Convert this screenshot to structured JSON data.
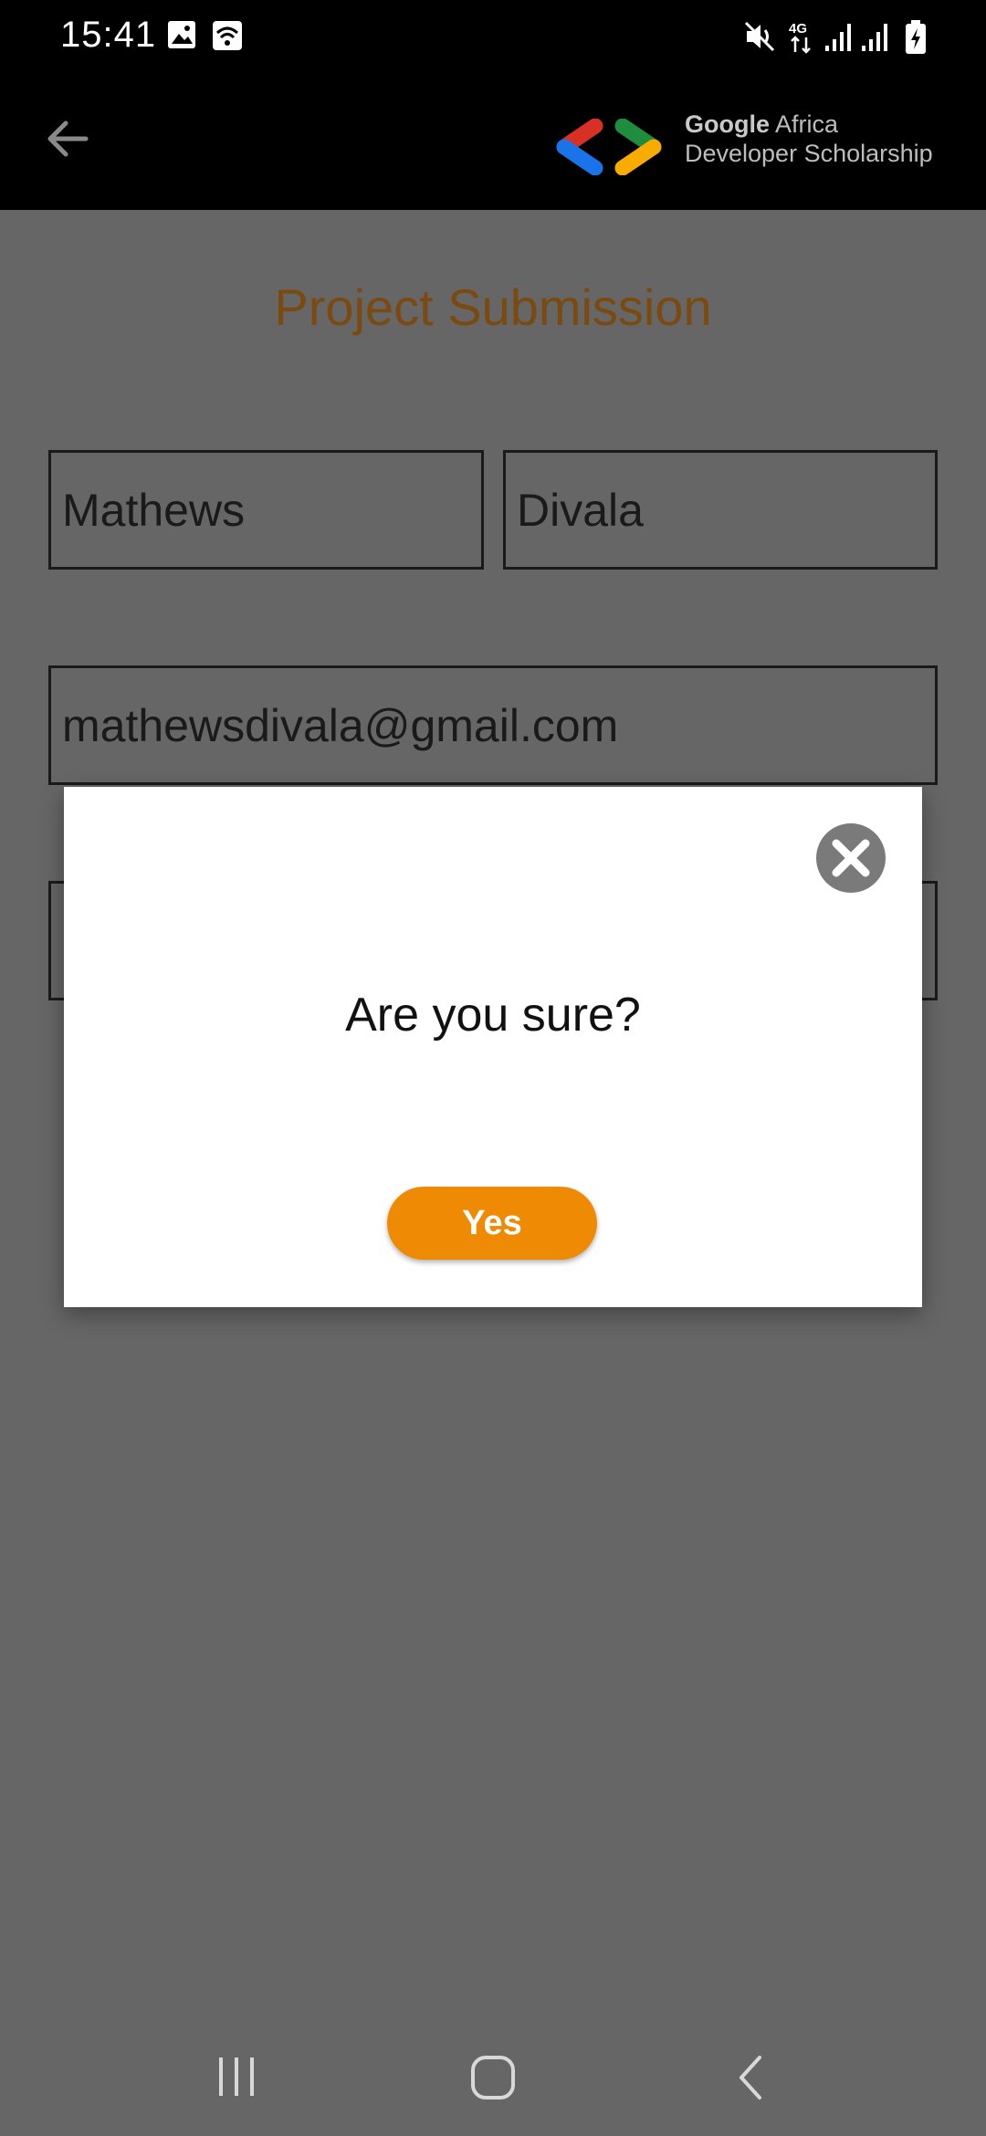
{
  "status_bar": {
    "time": "15:41",
    "icons": [
      "image-icon",
      "wifi-icon",
      "mute-icon",
      "network-4g-icon",
      "signal-icon",
      "signal-icon",
      "battery-charging-icon"
    ]
  },
  "app_bar": {
    "logo_brand": "Google",
    "logo_line1_rest": " Africa",
    "logo_line2": "Developer Scholarship",
    "colors": {
      "red": "#d93025",
      "blue": "#1a73e8",
      "green": "#1e8e3e",
      "yellow": "#f9ab00"
    }
  },
  "form": {
    "title": "Project Submission",
    "first_name": "Mathews",
    "last_name": "Divala",
    "email": "mathewsdivala@gmail.com",
    "github_link": ""
  },
  "dialog": {
    "message": "Are you sure?",
    "confirm_label": "Yes"
  },
  "nav_bar": {
    "icons": [
      "recents-icon",
      "home-icon",
      "back-icon"
    ]
  },
  "colors": {
    "accent": "#ef8a04",
    "title": "#7a4a10",
    "scrim": "#666666"
  }
}
